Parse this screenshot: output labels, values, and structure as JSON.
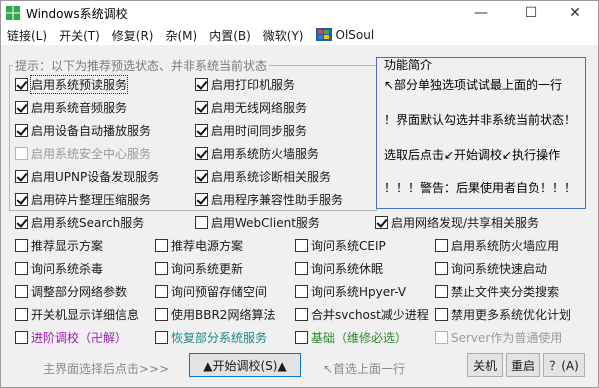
{
  "window": {
    "title": "Windows系统调校",
    "minimize": "—",
    "maximize": "☐",
    "close": "✕"
  },
  "menu": [
    "链接(L)",
    "开关(T)",
    "修复(R)",
    "杂(M)",
    "内置(B)",
    "微软(Y)",
    "OlSoul"
  ],
  "group": {
    "title": "提示：以下为推荐预选状态、并非系统当前状态"
  },
  "checkboxes": {
    "prefetch": {
      "label": "启用系统预读服务",
      "checked": true
    },
    "audio": {
      "label": "启用系统音频服务",
      "checked": true
    },
    "autoplay": {
      "label": "启用设备自动播放服务",
      "checked": true
    },
    "security_center": {
      "label": "启用系统安全中心服务",
      "checked": false
    },
    "upnp": {
      "label": "启用UPNP设备发现服务",
      "checked": true
    },
    "defrag": {
      "label": "启用碎片整理压缩服务",
      "checked": true
    },
    "search": {
      "label": "启用系统Search服务",
      "checked": true
    },
    "printer": {
      "label": "启用打印机服务",
      "checked": true
    },
    "wireless": {
      "label": "启用无线网络服务",
      "checked": true
    },
    "time_sync": {
      "label": "启用时间同步服务",
      "checked": true
    },
    "firewall": {
      "label": "启用系统防火墙服务",
      "checked": true
    },
    "diagnostics": {
      "label": "启用系统诊断相关服务",
      "checked": true
    },
    "compat": {
      "label": "启用程序兼容性助手服务",
      "checked": true
    },
    "webclient": {
      "label": "启用WebClient服务",
      "checked": false
    },
    "network_discovery": {
      "label": "启用网络发现/共享相关服务",
      "checked": true
    },
    "display_plan": {
      "label": "推荐显示方案",
      "checked": false
    },
    "power_plan": {
      "label": "推荐电源方案",
      "checked": false
    },
    "ceip": {
      "label": "询问系统CEIP",
      "checked": false
    },
    "fw_apply": {
      "label": "启用系统防火墙应用",
      "checked": false
    },
    "antivirus": {
      "label": "询问系统杀毒",
      "checked": false
    },
    "update": {
      "label": "询问系统更新",
      "checked": false
    },
    "hibernate": {
      "label": "询问系统休眠",
      "checked": false
    },
    "fast_boot": {
      "label": "询问系统快速启动",
      "checked": false
    },
    "net_params": {
      "label": "调整部分网络参数",
      "checked": false
    },
    "reserved_storage": {
      "label": "询问预留存储空间",
      "checked": false
    },
    "hyperv": {
      "label": "询问系统Hpyer-V",
      "checked": false
    },
    "folder_search": {
      "label": "禁止文件夹分类搜索",
      "checked": false
    },
    "boot_detail": {
      "label": "开关机显示详细信息",
      "checked": false
    },
    "bbr2": {
      "label": "使用BBR2网络算法",
      "checked": false
    },
    "svchost": {
      "label": "合并svchost减少进程",
      "checked": false
    },
    "more_plans": {
      "label": "禁用更多系统优化计划",
      "checked": false
    },
    "advanced": {
      "label": "进阶调校（卍解）",
      "checked": false
    },
    "restore_services": {
      "label": "恢复部分系统服务",
      "checked": false
    },
    "base_maintenance": {
      "label": "基础（维修必选）",
      "checked": false
    },
    "server_mode": {
      "label": "Server作为普通使用",
      "checked": false
    }
  },
  "info": {
    "title": "功能简介",
    "lines": [
      "↖部分单独选项试试最上面的一行",
      "！界面默认勾选并非系统当前状态！",
      "选取后点击↙开始调校↙执行操作",
      "！！！警告：后果使用者自负！！！"
    ]
  },
  "bottom": {
    "hint_left": "主界面选择后点击>>>",
    "start_button": "▲开始调校(S)▲",
    "hint_right": "↖首选上面一行",
    "shutdown": "关机",
    "restart": "重启",
    "help": "？(A)"
  }
}
